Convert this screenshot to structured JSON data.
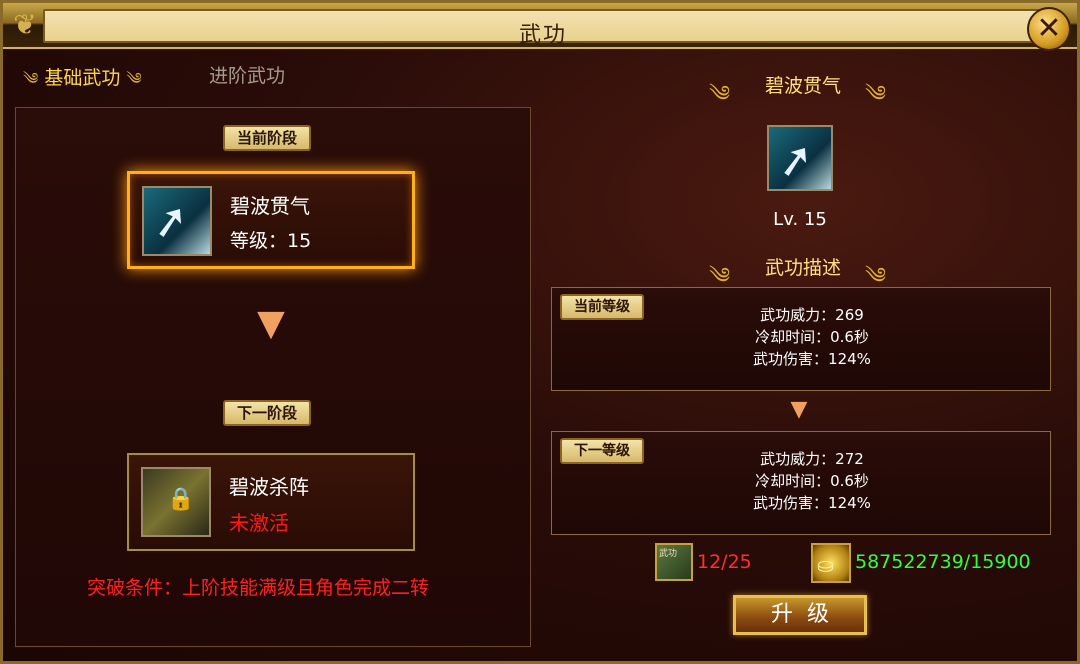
{
  "window": {
    "title": "武功",
    "close_icon": "close-icon"
  },
  "tabs": [
    {
      "label": "基础武功",
      "active": true
    },
    {
      "label": "进阶武功",
      "active": false
    }
  ],
  "left": {
    "current_stage_label": "当前阶段",
    "current_skill": {
      "name": "碧波贯气",
      "level_text": "等级：15",
      "icon": "spear-skill-icon"
    },
    "next_stage_label": "下一阶段",
    "next_skill": {
      "name": "碧波杀阵",
      "status": "未激活",
      "icon": "locked-skill-icon"
    },
    "breakthrough": "突破条件：上阶技能满级且角色完成二转"
  },
  "right": {
    "skill_name": "碧波贯气",
    "level": "Lv. 15",
    "desc_title": "武功描述",
    "current": {
      "label": "当前等级",
      "power": "武功威力：269",
      "cooldown": "冷却时间：0.6秒",
      "damage": "武功伤害：124%"
    },
    "next": {
      "label": "下一等级",
      "power": "武功威力：272",
      "cooldown": "冷却时间：0.6秒",
      "damage": "武功伤害：124%"
    },
    "cost_item_icon_label": "武功",
    "cost_item": "12/25",
    "cost_gold": "587522739/15900",
    "upgrade_label": "升级"
  },
  "colors": {
    "gold": "#ffd84a",
    "red": "#ff2020",
    "green": "#30ff40"
  }
}
